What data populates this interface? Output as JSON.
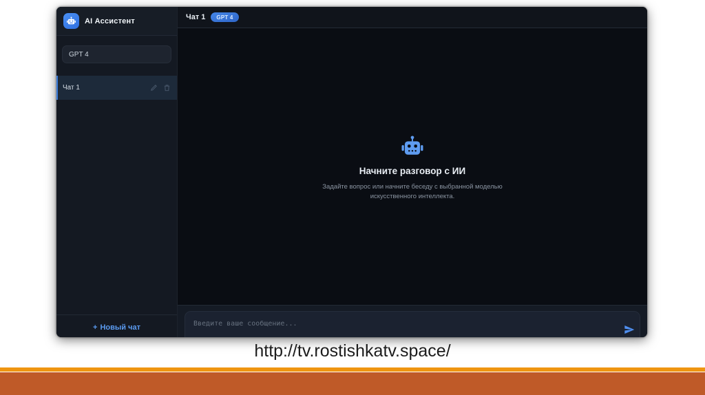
{
  "app": {
    "title": "AI Ассистент"
  },
  "sidebar": {
    "model_select": {
      "value": "GPT 4"
    },
    "chats": [
      {
        "label": "Чат 1",
        "active": true
      }
    ],
    "new_chat": {
      "plus": "+",
      "label": "Новый чат"
    }
  },
  "header": {
    "chat_title": "Чат 1",
    "model_badge": "GPT 4"
  },
  "empty_state": {
    "title": "Начните разговор с ИИ",
    "subtitle": "Задайте вопрос или начните беседу с выбранной моделью искусственного интеллекта."
  },
  "composer": {
    "placeholder": "Введите ваше сообщение...",
    "value": ""
  },
  "caption": {
    "url": "http://tv.rostishkatv.space/"
  },
  "colors": {
    "accent_blue": "#4a90f4",
    "robot_blue": "#5e9cf1",
    "badge_blue": "#3c7ade",
    "bar_accent_orange": "#ef9511",
    "bar_main_orange": "#bf5a28",
    "sidebar_bg": "#141922",
    "chat_bg": "#0a0d13",
    "active_chat_bg": "#1d2a3a"
  }
}
